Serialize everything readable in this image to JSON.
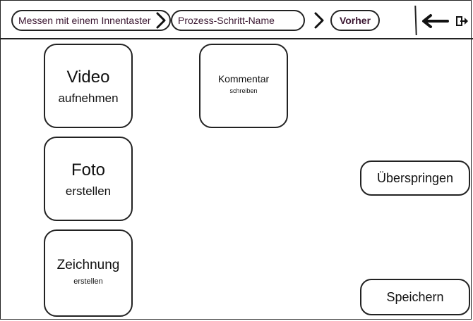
{
  "breadcrumb": {
    "items": [
      {
        "label": "Messen mit einem Innentaster"
      },
      {
        "label": "Prozess-Schritt-Name"
      },
      {
        "label": "Vorher"
      }
    ]
  },
  "toolbar": {
    "back_icon": "arrow-left-icon",
    "exit_icon": "exit-icon"
  },
  "tiles": {
    "video": {
      "title": "Video",
      "subtitle": "aufnehmen"
    },
    "foto": {
      "title": "Foto",
      "subtitle": "erstellen"
    },
    "zeichnung": {
      "title": "Zeichnung",
      "subtitle": "erstellen"
    },
    "kommentar": {
      "title": "Kommentar",
      "subtitle": "schreiben"
    }
  },
  "actions": {
    "skip_label": "Überspringen",
    "save_label": "Speichern"
  }
}
